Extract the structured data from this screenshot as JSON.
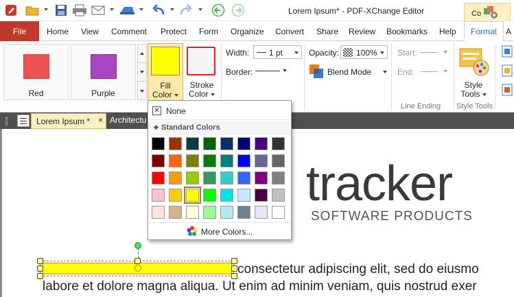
{
  "window": {
    "title": "Lorem Ipsum* - PDF-XChange Editor",
    "context_tab": "Co"
  },
  "menu": {
    "file": "File",
    "items": [
      "Home",
      "View",
      "Comment",
      "Protect",
      "Form",
      "Organize",
      "Convert",
      "Share",
      "Review",
      "Bookmarks",
      "Help"
    ],
    "active_tab": "Format",
    "overflow": "A"
  },
  "ribbon": {
    "styles": [
      {
        "label": "Red",
        "color": "#ef5350"
      },
      {
        "label": "Purple",
        "color": "#a845c1"
      }
    ],
    "fill_color": {
      "label_1": "Fill",
      "label_2": "Color",
      "value": "#ffff00"
    },
    "stroke_color": {
      "label_1": "Stroke",
      "label_2": "Color",
      "value": "#e02020"
    },
    "width": {
      "label": "Width:",
      "value": "1 pt"
    },
    "border": {
      "label": "Border:"
    },
    "opacity": {
      "label": "Opacity:",
      "value": "100%"
    },
    "blend_mode": {
      "label": "Blend Mode"
    },
    "line_ending": {
      "start": "Start:",
      "end": "End:",
      "group_label": "Line Ending"
    },
    "style_tools": {
      "label_1": "Style",
      "label_2": "Tools",
      "group_label": "Style Tools"
    }
  },
  "doc_tabs": {
    "active": "Lorem Ipsum *",
    "second": "Architectu"
  },
  "document": {
    "logo_main": "tracker",
    "logo_sub": "SOFTWARE PRODUCTS",
    "line1": "consectetur adipiscing elit, sed do eiusmo",
    "line2": "labore et dolore magna aliqua. Ut enim ad minim veniam, quis nostrud exer"
  },
  "fill_dropdown": {
    "none_label": "None",
    "standard_header": "Standard Colors",
    "more_label": "More Colors...",
    "selected_color": "#ffff00",
    "colors": [
      [
        "#000000",
        "#993300",
        "#003f3f",
        "#006400",
        "#003366",
        "#000080",
        "#4b0082",
        "#333333"
      ],
      [
        "#800000",
        "#ff6600",
        "#808000",
        "#008000",
        "#008080",
        "#0000ff",
        "#666699",
        "#666666"
      ],
      [
        "#ff0000",
        "#ff9900",
        "#99cc00",
        "#339966",
        "#33cccc",
        "#3366ff",
        "#800080",
        "#808080"
      ],
      [
        "#ffc0cb",
        "#ffcc00",
        "#ffff00",
        "#00ff00",
        "#00e5e5",
        "#bfeaff",
        "#4a0040",
        "#c0c0c0"
      ],
      [
        "#ffe4e1",
        "#d2b48c",
        "#ffffe0",
        "#98fb98",
        "#afeeee",
        "#708090",
        "#e6e6fa",
        "#ffffff"
      ]
    ]
  }
}
